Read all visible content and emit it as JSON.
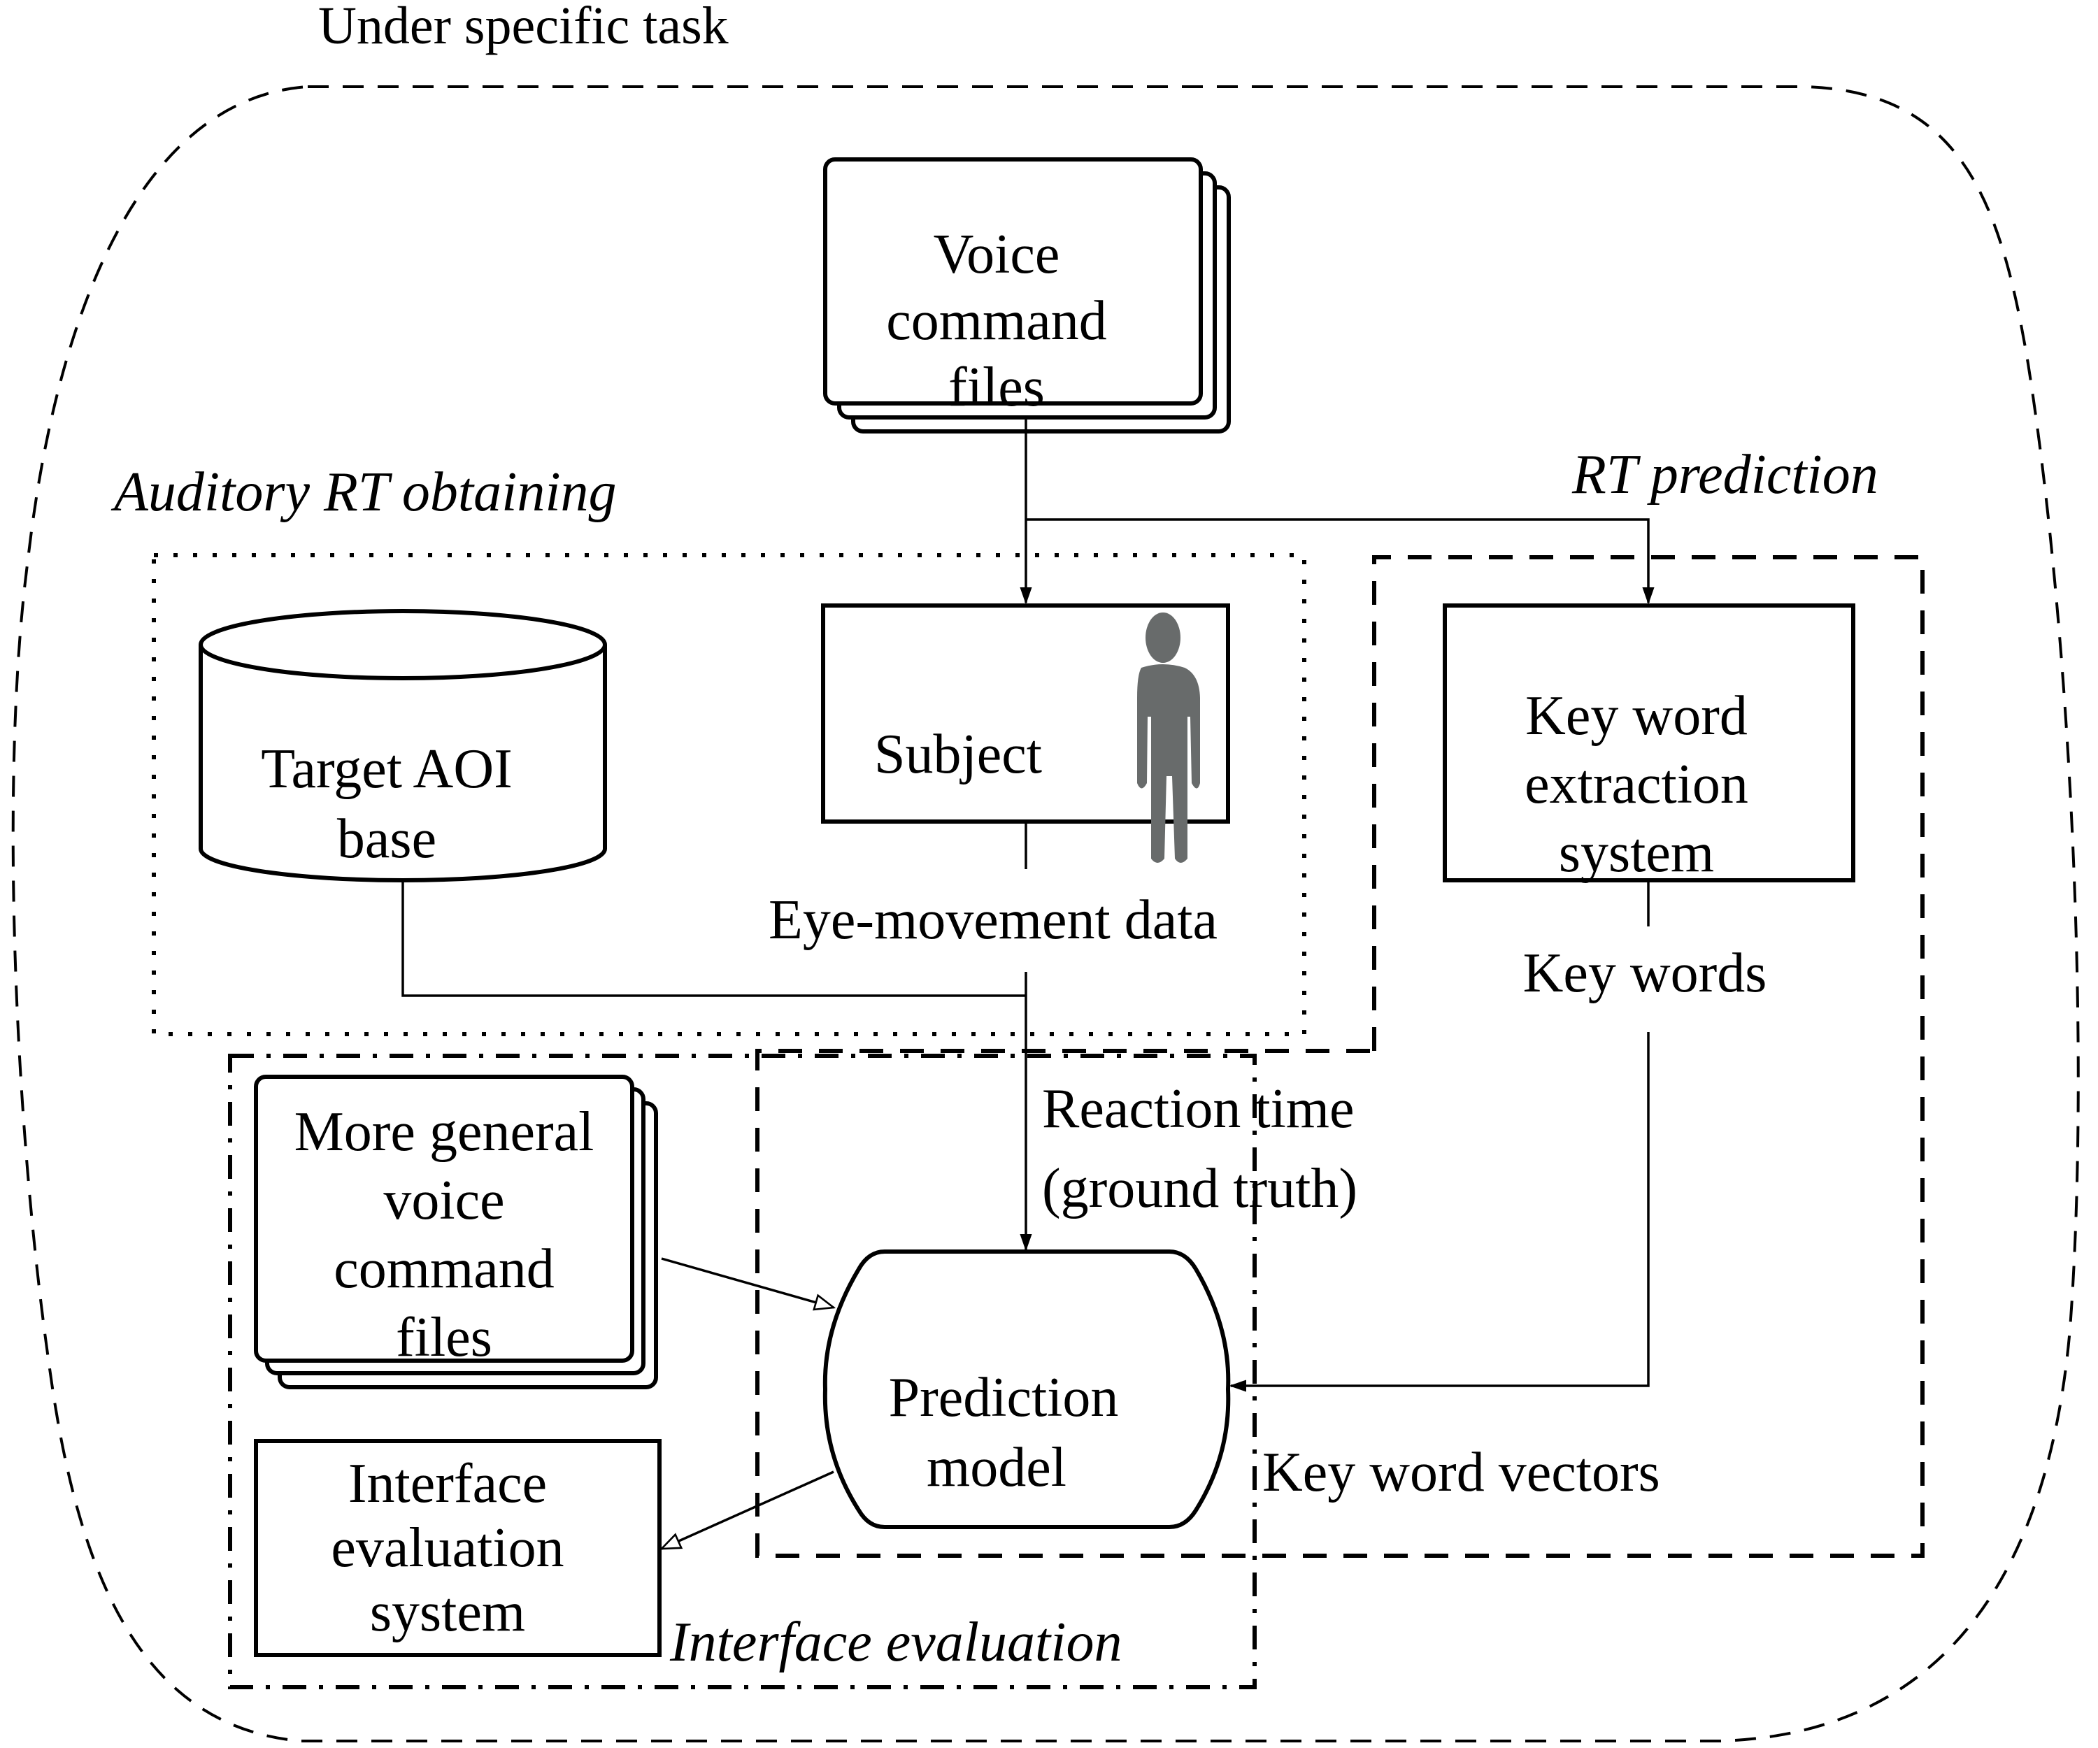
{
  "title": "Under specific task",
  "regions": {
    "auditory": "Auditory RT obtaining",
    "rt_prediction": "RT prediction",
    "interface_evaluation": "Interface evaluation"
  },
  "nodes": {
    "voice_files": [
      "Voice",
      "command",
      "files"
    ],
    "target_aoi": [
      "Target AOI",
      "base"
    ],
    "subject": "Subject",
    "keyword_system": [
      "Key word",
      "extraction",
      "system"
    ],
    "general_voice": [
      "More general",
      "voice",
      "command",
      "files"
    ],
    "prediction_model": [
      "Prediction",
      "model"
    ],
    "interface_system": [
      "Interface",
      "evaluation",
      "system"
    ]
  },
  "edges": {
    "eye_movement": "Eye-movement data",
    "key_words": "Key words",
    "reaction_time": [
      "Reaction time",
      "(ground truth)"
    ],
    "key_word_vectors": "Key word vectors"
  },
  "icons": {
    "subject_icon": "person-icon"
  },
  "colors": {
    "person_icon": "#686b6b"
  }
}
